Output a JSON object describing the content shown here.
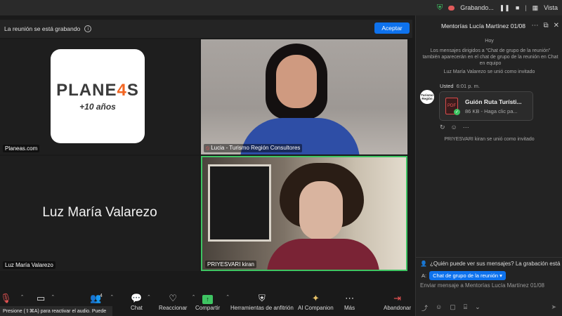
{
  "status_bar": {
    "recording_label": "Grabando...",
    "view_label": "Vista"
  },
  "banner": {
    "text": "La reunión se está grabando",
    "accept_label": "Aceptar"
  },
  "tiles": {
    "planeas": {
      "logo_word": "PLANE",
      "logo_letter": "4",
      "logo_end": "S",
      "logo_sub": "+10 años",
      "label": "Planeas.com"
    },
    "lucia": {
      "label": "Lucia - Turismo Región Consultores"
    },
    "luz": {
      "center_name": "Luz María Valarezo",
      "label": "Luz María Valarezo"
    },
    "priyesvari": {
      "label": "PRIYESVARI kiran"
    }
  },
  "chat": {
    "title": "Mentorías Lucía Martínez 01/08",
    "day": "Hoy",
    "notice": "Los mensajes dirigidos a \"Chat de grupo de la reunión\" también aparecerán en el chat de grupo de la reunión en Chat en equipo",
    "join1": "Luz María Valarezo se unió como invitado",
    "sender": "Usted",
    "time": "6:01 p. m.",
    "avatar_text": "Turismo Región",
    "file_name": "Guión Ruta Turísti...",
    "file_info": "86 KB - Haga clic pa...",
    "join2": "PRIYESVARI kiran se unió como invitado",
    "who_text": "¿Quién puede ver sus mensajes? La grabación está ha",
    "to_label": "A:",
    "to_target": "Chat de grupo de la reunión",
    "compose_placeholder": "Enviar mensaje a Mentorías Lucía Martínez 01/08"
  },
  "toolbar": {
    "participants_count": "4",
    "chat": "Chat",
    "reactions": "Reaccionar",
    "share": "Compartir",
    "host_tools": "Herramientas de anfitrión",
    "ai": "AI Companion",
    "more": "Más",
    "leave": "Abandonar",
    "tooltip": "Presione  (⇧⌘A) para reactivar el audio. Puede"
  },
  "colors": {
    "accent": "#0e72ed",
    "active_speaker": "#3ec462",
    "brand_orange": "#f26522"
  }
}
